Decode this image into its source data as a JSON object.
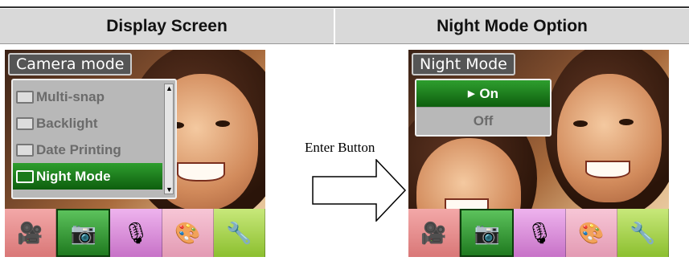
{
  "headers": {
    "left": "Display Screen",
    "right": "Night Mode Option"
  },
  "left_screen": {
    "menu_title": "Camera mode",
    "items": [
      {
        "label": "Multi-snap",
        "icon": "multi-snap-icon",
        "selected": false
      },
      {
        "label": "Backlight",
        "icon": "backlight-icon",
        "selected": false
      },
      {
        "label": "Date Printing",
        "icon": "date-printing-icon",
        "selected": false
      },
      {
        "label": "Night Mode",
        "icon": "night-mode-icon",
        "selected": true
      }
    ]
  },
  "right_screen": {
    "menu_title": "Night Mode",
    "options": [
      {
        "label": "On",
        "selected": true
      },
      {
        "label": "Off",
        "selected": false
      }
    ]
  },
  "arrow": {
    "label": "Enter Button"
  },
  "tray_icons": [
    "video-camera-icon",
    "camera-icon",
    "microphone-icon",
    "palette-icon",
    "tools-icon"
  ],
  "colors": {
    "selected_green": "#1f7a1f",
    "menu_gray": "#b8b8b8",
    "header_gray": "#d9d9d9"
  }
}
